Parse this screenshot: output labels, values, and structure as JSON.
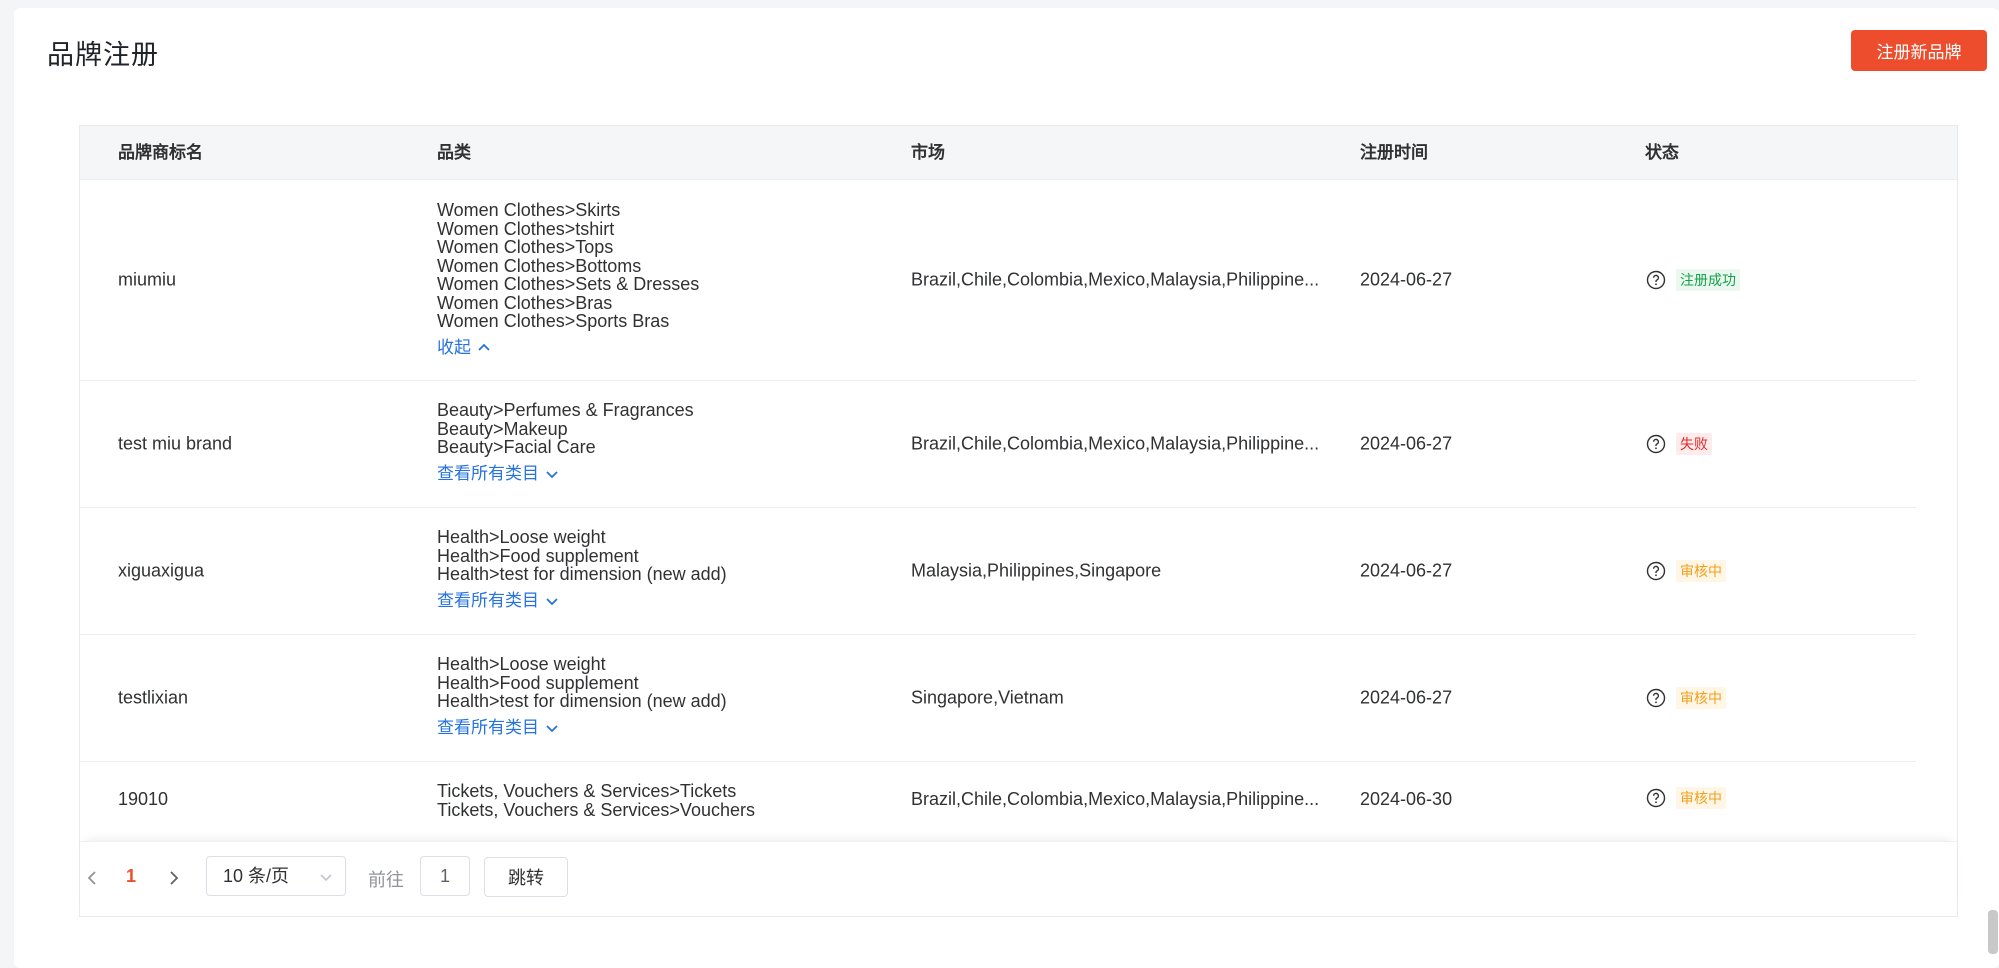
{
  "page": {
    "title": "品牌注册",
    "register_button": "注册新品牌"
  },
  "table": {
    "headers": {
      "brand": "品牌商标名",
      "category": "品类",
      "market": "市场",
      "time": "注册时间",
      "status": "状态"
    },
    "rows": [
      {
        "brand": "miumiu",
        "categories": [
          "Women Clothes>Skirts",
          "Women Clothes>tshirt",
          "Women Clothes>Tops",
          "Women Clothes>Bottoms",
          "Women Clothes>Sets & Dresses",
          "Women Clothes>Bras",
          "Women Clothes>Sports Bras"
        ],
        "toggle": "收起",
        "market": "Brazil,Chile,Colombia,Mexico,Malaysia,Philippine...",
        "time": "2024-06-27",
        "status": "注册成功"
      },
      {
        "brand": "test miu brand",
        "categories": [
          "Beauty>Perfumes & Fragrances",
          "Beauty>Makeup",
          "Beauty>Facial Care"
        ],
        "toggle": "查看所有类目",
        "market": "Brazil,Chile,Colombia,Mexico,Malaysia,Philippine...",
        "time": "2024-06-27",
        "status": "失败"
      },
      {
        "brand": "xiguaxigua",
        "categories": [
          "Health>Loose weight",
          "Health>Food supplement",
          "Health>test for dimension (new add)"
        ],
        "toggle": "查看所有类目",
        "market": "Malaysia,Philippines,Singapore",
        "time": "2024-06-27",
        "status": "审核中"
      },
      {
        "brand": "testlixian",
        "categories": [
          "Health>Loose weight",
          "Health>Food supplement",
          "Health>test for dimension (new add)"
        ],
        "toggle": "查看所有类目",
        "market": "Singapore,Vietnam",
        "time": "2024-06-27",
        "status": "审核中"
      },
      {
        "brand": "19010",
        "categories": [
          "Tickets, Vouchers & Services>Tickets",
          "Tickets, Vouchers & Services>Vouchers"
        ],
        "market": "Brazil,Chile,Colombia,Mexico,Malaysia,Philippine...",
        "time": "2024-06-30",
        "status": "审核中"
      }
    ]
  },
  "pagination": {
    "current_page": "1",
    "page_size": "10 条/页",
    "goto_label": "前往",
    "goto_value": "1",
    "jump_button": "跳转"
  }
}
